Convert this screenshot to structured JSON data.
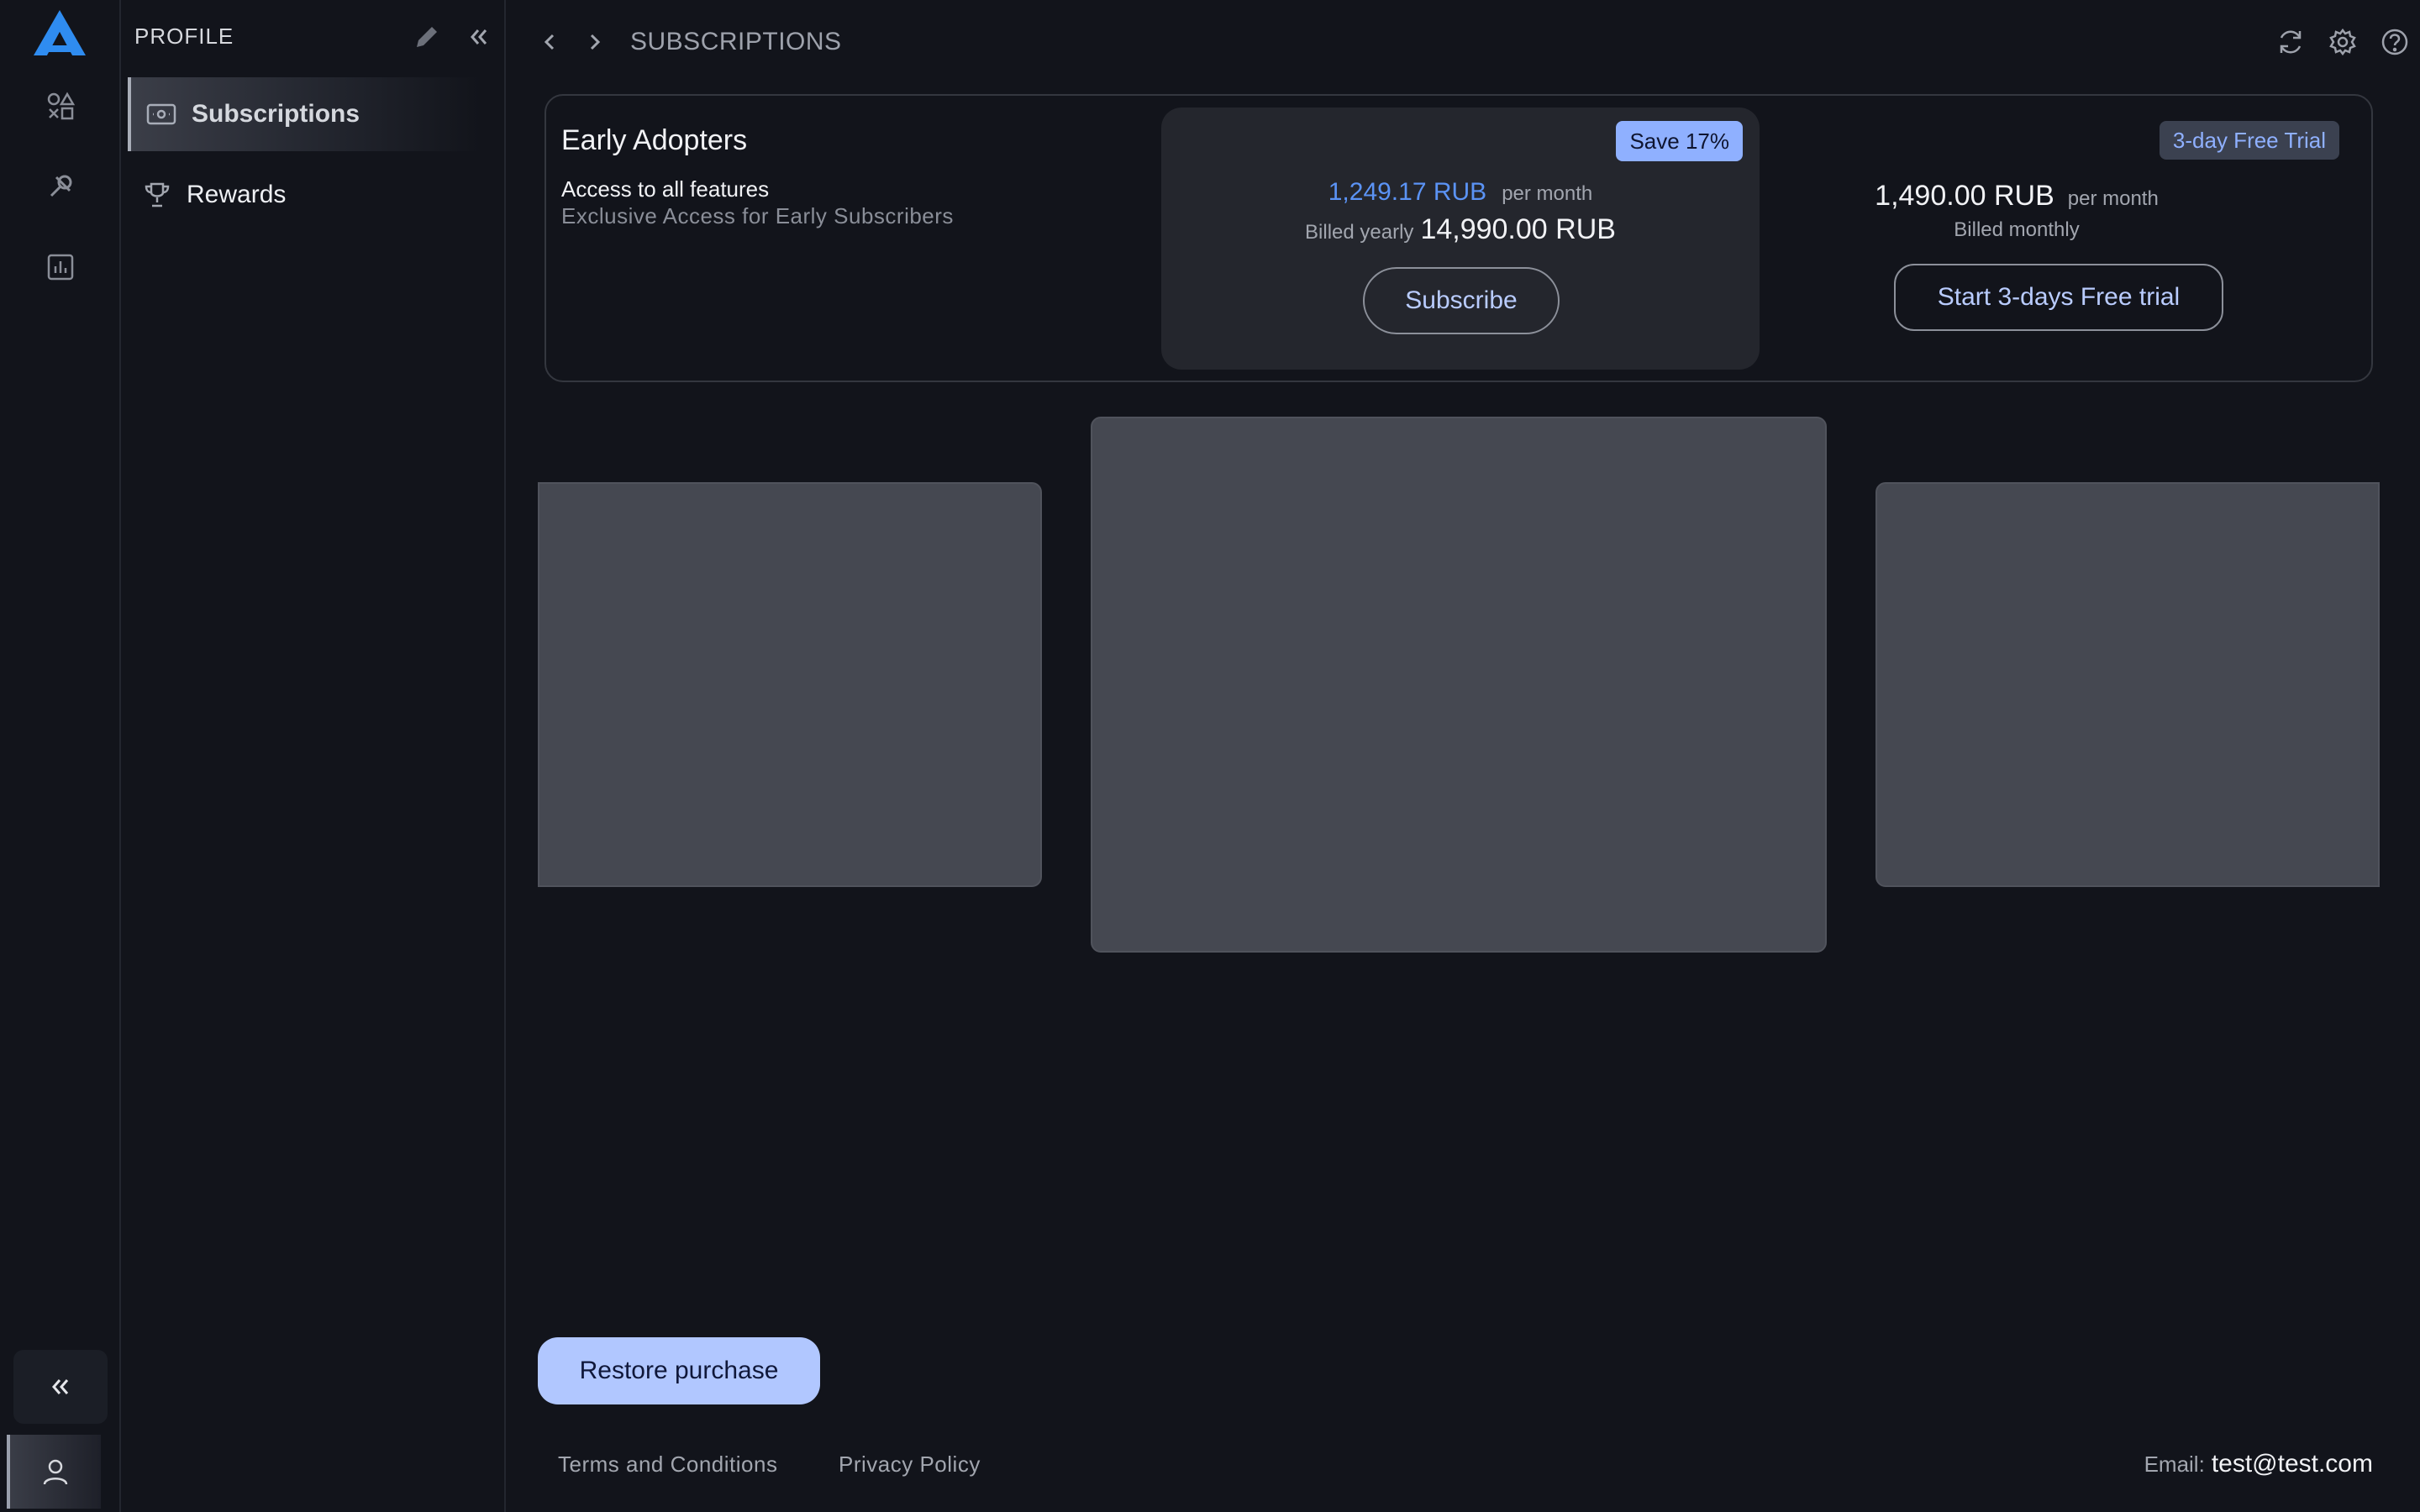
{
  "sidebar": {
    "title": "PROFILE",
    "items": [
      {
        "label": "Subscriptions",
        "icon": "cash-icon",
        "active": true
      },
      {
        "label": "Rewards",
        "icon": "trophy-icon",
        "active": false
      }
    ]
  },
  "header": {
    "title": "SUBSCRIPTIONS"
  },
  "plan": {
    "name": "Early Adopters",
    "feature": "Access to all features",
    "description": "Exclusive Access for Early Subscribers",
    "yearly": {
      "badge": "Save 17%",
      "price": "1,249.17 RUB",
      "period": "per month",
      "billed_label": "Billed yearly",
      "billed_amount": "14,990.00 RUB",
      "button": "Subscribe"
    },
    "monthly": {
      "badge": "3-day Free Trial",
      "price": "1,490.00 RUB",
      "period": "per month",
      "billed": "Billed monthly",
      "button": "Start 3-days Free trial"
    }
  },
  "footer": {
    "restore": "Restore purchase",
    "terms": "Terms and Conditions",
    "privacy": "Privacy Policy",
    "email_label": "Email:",
    "email": "test@test.com"
  },
  "colors": {
    "accent": "#5b93f5",
    "badge": "#8fb0ff",
    "restore_button": "#b1c7ff",
    "background": "#12141b"
  }
}
